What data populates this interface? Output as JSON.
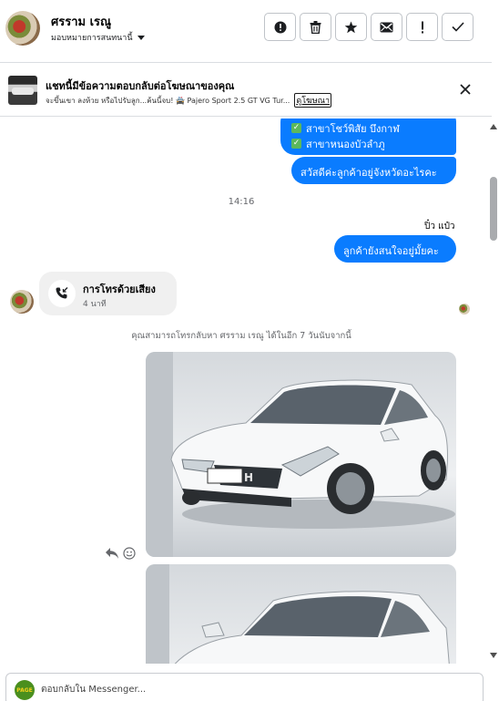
{
  "header": {
    "contact_name": "ศรราม เรณู",
    "assign_label": "มอบหมายการสนทนานี้",
    "actions": [
      {
        "icon": "alert-circle-icon",
        "name": "mark-spam-button"
      },
      {
        "icon": "trash-icon",
        "name": "delete-button"
      },
      {
        "icon": "star-icon",
        "name": "star-button"
      },
      {
        "icon": "mail-icon",
        "name": "mark-unread-button"
      },
      {
        "icon": "exclamation-icon",
        "name": "flag-button"
      },
      {
        "icon": "check-icon",
        "name": "mark-done-button"
      }
    ]
  },
  "banner": {
    "title": "แชทนี้มีข้อความตอบกลับต่อโฆษณาของคุณ",
    "subtitle": "จะขึ้นเขา ลงห้วย หรือไปรับลูก...ค้นนี้จบ! 🚔 Pajero Sport 2.5 GT VG Tur...",
    "link": "ดูโฆษณา"
  },
  "messages": {
    "list_items": [
      "สาขาโชว์พิสัย บึงกาฬ",
      "สาขาหนองบัวลำภู"
    ],
    "greeting": "สวัสดีค่ะลูกค้าอยู่จังหวัดอะไรคะ",
    "timestamp": "14:16",
    "sender_name": "ปิ๋ว แป๋ว",
    "question": "ลูกค้ายังสนใจอยู่มั้ยคะ",
    "call": {
      "title": "การโทรด้วยเสียง",
      "duration": "4 นาที"
    },
    "notice": "คุณสามารถโทรกลับหา ศรราม เรณู ได้ในอีก 7 วันนับจากนี้"
  },
  "composer": {
    "placeholder": "ตอบกลับใน Messenger..."
  },
  "colors": {
    "bubble_blue": "#0a7cff",
    "incoming_bubble": "#f0f0f0",
    "check_green": "#5cb85c"
  }
}
